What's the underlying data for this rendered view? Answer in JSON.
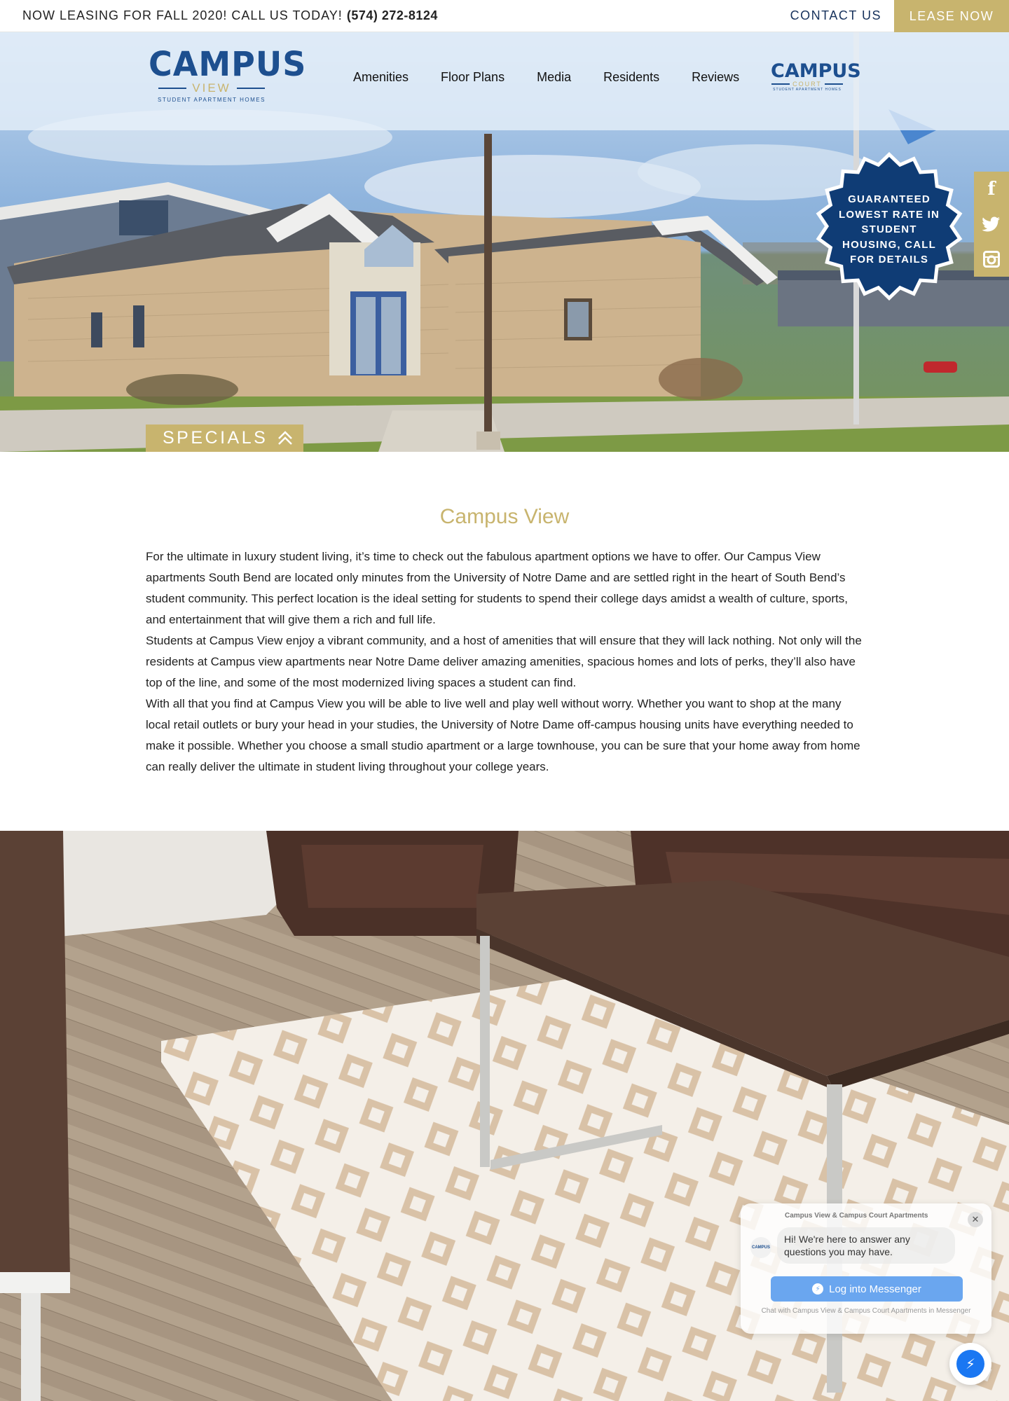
{
  "topbar": {
    "announcement": "NOW LEASING FOR FALL 2020! CALL US TODAY!",
    "phone": "(574) 272-8124",
    "contact_label": "CONTACT US",
    "lease_label": "LEASE NOW"
  },
  "logos": {
    "main": {
      "word": "CAMPUS",
      "sub_word": "VIEW",
      "tagline": "STUDENT APARTMENT HOMES"
    },
    "secondary": {
      "word": "CAMPUS",
      "sub_word": "COURT",
      "tagline": "STUDENT APARTMENT HOMES"
    }
  },
  "nav": {
    "items": [
      "Amenities",
      "Floor Plans",
      "Media",
      "Residents",
      "Reviews"
    ]
  },
  "badge": {
    "text": "GUARANTEED LOWEST RATE IN STUDENT HOUSING, CALL FOR DETAILS",
    "color": "#0f3c75"
  },
  "social": [
    {
      "icon": "facebook-icon",
      "glyph": "f"
    },
    {
      "icon": "twitter-icon",
      "glyph": "🐦"
    },
    {
      "icon": "instagram-icon",
      "glyph": "◘"
    }
  ],
  "specials": {
    "label": "SPECIALS"
  },
  "intro": {
    "title": "Campus View",
    "paragraphs": [
      "For the ultimate in luxury student living, it’s time to check out the fabulous apartment options we have to offer. Our Campus View apartments South Bend are located only minutes from the University of Notre Dame and are settled right in the heart of South Bend’s student community. This perfect location is the ideal setting for students to spend their college days amidst a wealth of culture, sports, and entertainment that will give them a rich and full life.",
      "Students at Campus View enjoy a vibrant community, and a host of amenities that will ensure that they will lack nothing. Not only will the residents at Campus view apartments near Notre Dame deliver amazing amenities, spacious homes and lots of perks, they’ll also have top of the line, and some of the most modernized living spaces a student can find.",
      "With all that you find at Campus View you will be able to live well and play well without worry. Whether you want to shop at the many local retail outlets or bury your head in your studies, the University of Notre Dame off-campus housing units have everything needed to make it possible. Whether you choose a small studio apartment or a large townhouse, you can be sure that your home away from home can really deliver the ultimate in student living throughout your college years."
    ]
  },
  "messenger": {
    "page_name": "Campus View & Campus Court Apartments",
    "greeting": "Hi! We're here to answer any questions you may have.",
    "button_label": "Log into Messenger",
    "footer": "Chat with Campus View & Campus Court Apartments in Messenger",
    "avatar_text": "CAMPUS"
  },
  "colors": {
    "gold": "#c8b46e",
    "navy": "#17325c",
    "logo_blue": "#1d4f8f",
    "messenger_blue": "#1a77f2"
  }
}
